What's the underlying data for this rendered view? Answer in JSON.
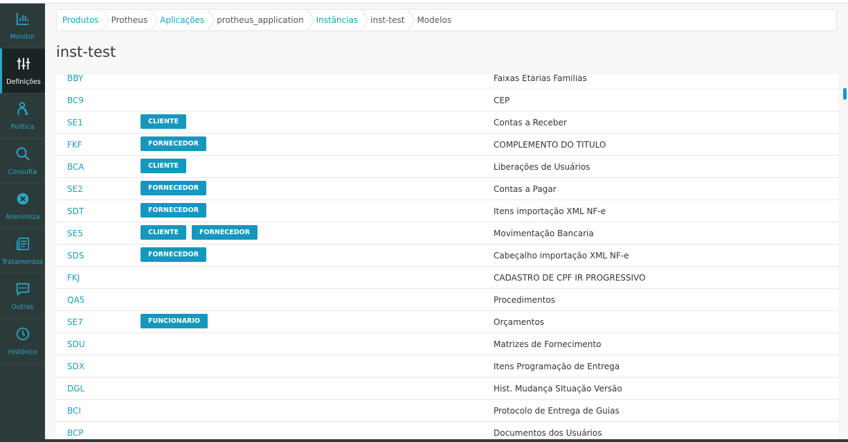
{
  "sidebar": {
    "items": [
      {
        "label": "Monitor",
        "icon": "bar-chart-icon"
      },
      {
        "label": "Definições",
        "icon": "sliders-icon"
      },
      {
        "label": "Política",
        "icon": "person-icon"
      },
      {
        "label": "Consulta",
        "icon": "search-icon"
      },
      {
        "label": "Anonimiza",
        "icon": "close-circle-icon"
      },
      {
        "label": "Tratamentos",
        "icon": "document-list-icon"
      },
      {
        "label": "Outras",
        "icon": "chat-icon"
      },
      {
        "label": "Histórico",
        "icon": "clock-icon"
      }
    ],
    "active_index": 1
  },
  "breadcrumb": [
    {
      "label": "Produtos",
      "link": true
    },
    {
      "label": "Protheus",
      "link": false
    },
    {
      "label": "Aplicações",
      "link": true
    },
    {
      "label": "protheus_application",
      "link": false
    },
    {
      "label": "Instâncias",
      "link": true
    },
    {
      "label": "inst-test",
      "link": false
    },
    {
      "label": "Modelos",
      "link": false
    }
  ],
  "page": {
    "title": "inst-test"
  },
  "models": [
    {
      "code": "BBY",
      "tags": [],
      "description": "Faixas Etárias Famílias"
    },
    {
      "code": "BC9",
      "tags": [],
      "description": "CEP"
    },
    {
      "code": "SE1",
      "tags": [
        "CLIENTE"
      ],
      "description": "Contas a Receber"
    },
    {
      "code": "FKF",
      "tags": [
        "FORNECEDOR"
      ],
      "description": "COMPLEMENTO DO TITULO"
    },
    {
      "code": "BCA",
      "tags": [
        "CLIENTE"
      ],
      "description": "Liberações de Usuários"
    },
    {
      "code": "SE2",
      "tags": [
        "FORNECEDOR"
      ],
      "description": "Contas a Pagar"
    },
    {
      "code": "SDT",
      "tags": [
        "FORNECEDOR"
      ],
      "description": "Itens importação XML NF-e"
    },
    {
      "code": "SE5",
      "tags": [
        "CLIENTE",
        "FORNECEDOR"
      ],
      "description": "Movimentação Bancaria"
    },
    {
      "code": "SDS",
      "tags": [
        "FORNECEDOR"
      ],
      "description": "Cabeçalho importação XML NF-e"
    },
    {
      "code": "FKJ",
      "tags": [],
      "description": "CADASTRO DE CPF IR PROGRESSIVO"
    },
    {
      "code": "QA5",
      "tags": [],
      "description": "Procedimentos"
    },
    {
      "code": "SE7",
      "tags": [
        "FUNCIONARIO"
      ],
      "description": "Orçamentos"
    },
    {
      "code": "SDU",
      "tags": [],
      "description": "Matrizes de Fornecimento"
    },
    {
      "code": "SDX",
      "tags": [],
      "description": "Itens Programação de Entrega"
    },
    {
      "code": "DGL",
      "tags": [],
      "description": "Hist. Mudança SItuação Versão"
    },
    {
      "code": "BCI",
      "tags": [],
      "description": "Protocolo de Entrega de Guias"
    },
    {
      "code": "BCP",
      "tags": [],
      "description": "Documentos dos Usuários"
    }
  ]
}
